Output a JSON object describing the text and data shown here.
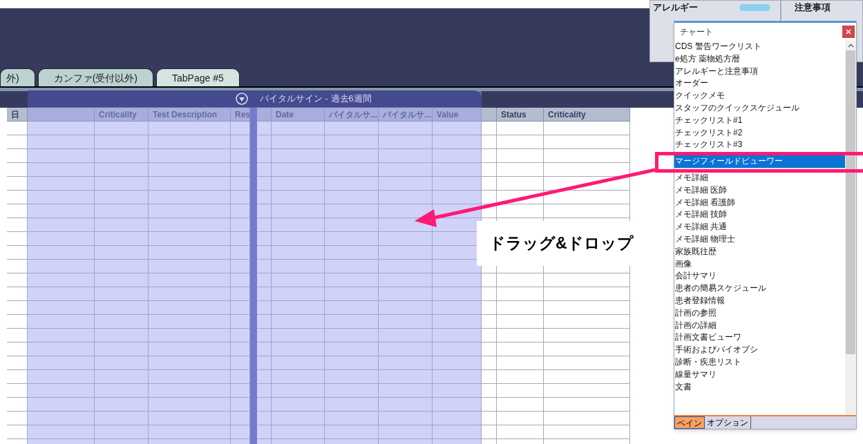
{
  "top_tabs": [
    {
      "label": "外)",
      "selected": false
    },
    {
      "label": "カンファ(受付以外)",
      "selected": false
    },
    {
      "label": "TabPage #5",
      "selected": true
    }
  ],
  "side_panels": [
    {
      "title": "アレルギー"
    },
    {
      "title": "注意事項"
    }
  ],
  "left_table": {
    "columns": [
      {
        "kind": "text",
        "label": "日"
      },
      {
        "kind": "blank"
      },
      {
        "kind": "text",
        "label": "Criticality"
      },
      {
        "kind": "text",
        "label": "Test Description"
      },
      {
        "kind": "text",
        "label": "Res"
      }
    ]
  },
  "right_table": {
    "columns": [
      {
        "kind": "blank"
      },
      {
        "kind": "text",
        "label": "Date"
      },
      {
        "kind": "text",
        "label": "バイタルサ..."
      },
      {
        "kind": "text",
        "label": "バイタルサ..."
      },
      {
        "kind": "text",
        "label": "Value"
      },
      {
        "kind": "blank"
      },
      {
        "kind": "text",
        "label": "Status"
      },
      {
        "kind": "text",
        "label": "Criticality"
      }
    ]
  },
  "drag_pane": {
    "title": "バイタルサイン - 過去6週間"
  },
  "popup": {
    "title": "チャート",
    "items": [
      {
        "label": "CDS 警告ワークリスト",
        "selected": false
      },
      {
        "label": "e処方 薬物処方暦",
        "selected": false
      },
      {
        "label": "アレルギーと注意事項",
        "selected": false
      },
      {
        "label": "オーダー",
        "selected": false
      },
      {
        "label": "クイックメモ",
        "selected": false
      },
      {
        "label": "スタッフのクイックスケジュール",
        "selected": false
      },
      {
        "label": "チェックリスト#1",
        "selected": false
      },
      {
        "label": "チェックリスト#2",
        "selected": false
      },
      {
        "label": "チェックリスト#3",
        "selected": false
      },
      {
        "label": "マージフィールドビューワー",
        "selected": true
      },
      {
        "label": "メモ詳細",
        "selected": false
      },
      {
        "label": "メモ詳細 医師",
        "selected": false
      },
      {
        "label": "メモ詳細 看護師",
        "selected": false
      },
      {
        "label": "メモ詳細 技師",
        "selected": false
      },
      {
        "label": "メモ詳細 共通",
        "selected": false
      },
      {
        "label": "メモ詳細 物理士",
        "selected": false
      },
      {
        "label": "家族既往歴",
        "selected": false
      },
      {
        "label": "画像",
        "selected": false
      },
      {
        "label": "会計サマリ",
        "selected": false
      },
      {
        "label": "患者の簡易スケジュール",
        "selected": false
      },
      {
        "label": "患者登録情報",
        "selected": false
      },
      {
        "label": "計画の参照",
        "selected": false
      },
      {
        "label": "計画の詳細",
        "selected": false
      },
      {
        "label": "計画文書ビューワ",
        "selected": false
      },
      {
        "label": "手術およびバイオプシ",
        "selected": false
      },
      {
        "label": "診断・疾患リスト",
        "selected": false
      },
      {
        "label": "線量サマリ",
        "selected": false
      },
      {
        "label": "文書",
        "selected": false
      }
    ],
    "tabs": [
      {
        "label": "ペイン",
        "selected": true
      },
      {
        "label": "オプション",
        "selected": false
      }
    ]
  },
  "annotation": {
    "label": "ドラッグ&ドロップ"
  }
}
